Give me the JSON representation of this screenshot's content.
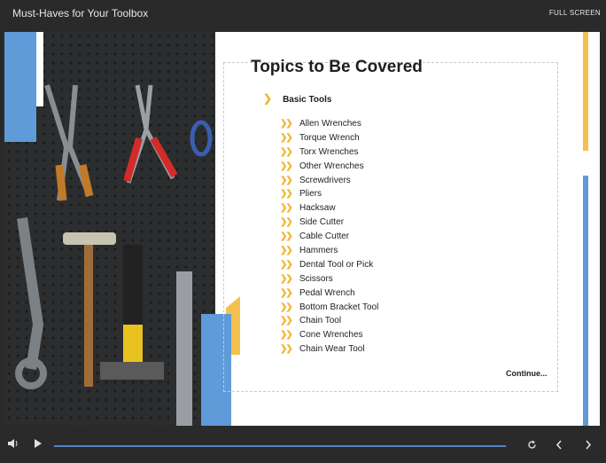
{
  "window": {
    "title": "Must-Haves for Your Toolbox",
    "fullscreen_label": "FULL SCREEN"
  },
  "slide": {
    "heading": "Topics to Be Covered",
    "section": "Basic Tools",
    "items": [
      "Allen Wrenches",
      "Torque Wrench",
      "Torx Wrenches",
      "Other Wrenches",
      "Screwdrivers",
      "Pliers",
      "Hacksaw",
      "Side Cutter",
      "Cable Cutter",
      "Hammers",
      "Dental Tool or Pick",
      "Scissors",
      "Pedal Wrench",
      "Bottom Bracket Tool",
      "Chain Tool",
      "Cone Wrenches",
      "Chain Wear Tool"
    ],
    "continue_label": "Continue..."
  },
  "player": {
    "progress_fraction": 1.0,
    "icons": [
      "volume-icon",
      "play-icon",
      "replay-icon",
      "prev-icon",
      "next-icon"
    ]
  },
  "colors": {
    "accent_blue": "#5f9bd9",
    "accent_yellow": "#f6c04e",
    "progress": "#4e86c9"
  }
}
